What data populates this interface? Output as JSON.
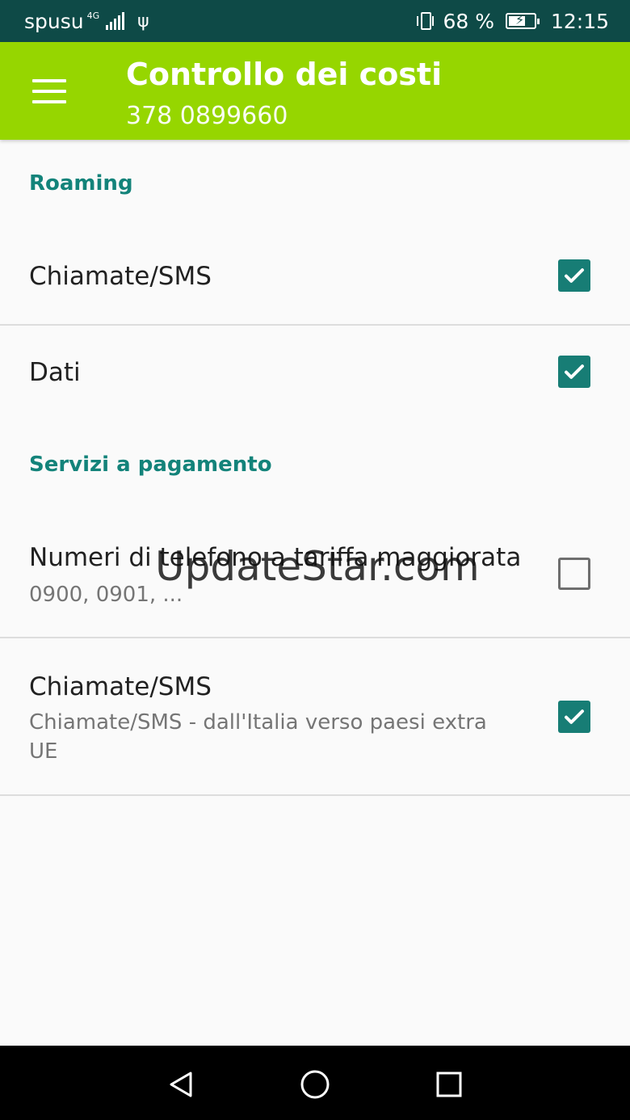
{
  "status_bar": {
    "carrier": "spusu",
    "network": "4G",
    "battery_percent": "68 %",
    "battery_level": 0.68,
    "time": "12:15"
  },
  "app_bar": {
    "title": "Controllo dei costi",
    "subtitle": "378 0899660",
    "menu_icon": "menu-icon",
    "color": "#96d600"
  },
  "sections": [
    {
      "header": "Roaming",
      "items": [
        {
          "title": "Chiamate/SMS",
          "checked": true
        },
        {
          "title": "Dati",
          "checked": true
        }
      ]
    },
    {
      "header": "Servizi a pagamento",
      "items": [
        {
          "title": "Numeri di telefono a tariffa maggiorata",
          "subtitle": "0900, 0901, ...",
          "checked": false
        },
        {
          "title": "Chiamate/SMS",
          "subtitle": "Chiamate/SMS - dall'Italia verso paesi extra UE",
          "checked": true
        }
      ]
    }
  ],
  "watermark": "UpdateStar.com",
  "accent_color": "#177d75",
  "nav_bar": {
    "icons": [
      "back-icon",
      "home-icon",
      "recent-apps-icon"
    ]
  }
}
